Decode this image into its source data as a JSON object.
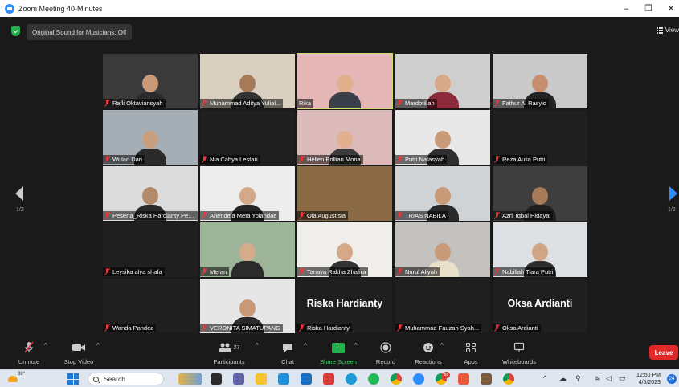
{
  "window": {
    "title": "Zoom Meeting 40-Minutes",
    "minimize": "–",
    "maximize": "❐",
    "close": "✕"
  },
  "topbar": {
    "sound_button": "Original Sound for Musicians: Off",
    "view_label": "View"
  },
  "gallery": {
    "page_left": "1/2",
    "page_right": "1/2",
    "tiles": [
      {
        "name": "Rafli Oktaviansyah",
        "bg": "#3a3a3a",
        "skin": "#c89a78",
        "cloth": "#2b2b2b"
      },
      {
        "name": "Muhammad Aditya Yulial...",
        "bg": "#d8cfc0",
        "skin": "#a87a5a",
        "cloth": "#333"
      },
      {
        "name": "Rika",
        "bg": "#e4b6b6",
        "skin": "#e0b08c",
        "cloth": "#3a3f4a",
        "active": true
      },
      {
        "name": "Mardotillah",
        "bg": "#cfcfcf",
        "skin": "#d8a888",
        "cloth": "#8a2a3a"
      },
      {
        "name": "Fathur Al Rasyid",
        "bg": "#c9c9c9",
        "skin": "#c49070",
        "cloth": "#222"
      },
      {
        "name": "Wulan Dari",
        "bg": "#a6aeb5",
        "skin": "#c8a080",
        "cloth": "#2a2a2a"
      },
      {
        "name": "Nia Cahya Lestari",
        "bg": "#1f1f1f",
        "skin": "#1f1f1f",
        "cloth": "#1f1f1f"
      },
      {
        "name": "Hellen Brillian Mona",
        "bg": "#ddbaba",
        "skin": "#e0b090",
        "cloth": "#3b3b3b"
      },
      {
        "name": "Putri Natasyah",
        "bg": "#e8e8e8",
        "skin": "#c89a78",
        "cloth": "#2f2f2f"
      },
      {
        "name": "Reza Aulia Putri",
        "bg": "#1f1f1f",
        "skin": "#1f1f1f",
        "cloth": "#1f1f1f"
      },
      {
        "name": "Peserta_Riska Hardianty Pen...",
        "bg": "#dcdcdc",
        "skin": "#b08a6a",
        "cloth": "#2b2b2b"
      },
      {
        "name": "Anendela Meta Yolandae",
        "bg": "#ededed",
        "skin": "#d4a888",
        "cloth": "#262626"
      },
      {
        "name": "Ola Augustisia",
        "bg": "#8a6b45",
        "skin": "#8a6b45",
        "cloth": "#5a8a4a"
      },
      {
        "name": "TRIAS NABILA",
        "bg": "#cfd3d6",
        "skin": "#c89a78",
        "cloth": "#2a2a2a"
      },
      {
        "name": "Azril Iqbal Hidayat",
        "bg": "#3e3e3e",
        "skin": "#a87a5a",
        "cloth": "#1f1f1f"
      },
      {
        "name": "Leysika alya shafa",
        "bg": "#1f1f1f",
        "skin": "#1f1f1f",
        "cloth": "#1f1f1f"
      },
      {
        "name": "Meran",
        "bg": "#9fb59a",
        "skin": "#d6ab8c",
        "cloth": "#2b2b2b"
      },
      {
        "name": "Tanaya Rakha Zhafira",
        "bg": "#f0eeea",
        "skin": "#d4a888",
        "cloth": "#333"
      },
      {
        "name": "Nurul Aliyah",
        "bg": "#c4c2be",
        "skin": "#c89a78",
        "cloth": "#e8e0c8"
      },
      {
        "name": "Nabillah Tiara Putri",
        "bg": "#dde0e3",
        "skin": "#d0a484",
        "cloth": "#2e2e2e"
      },
      {
        "name": "Wanda Pandea",
        "bg": "#1f1f1f",
        "skin": "#1f1f1f",
        "cloth": "#1f1f1f"
      },
      {
        "name": "VERONITA SIMATUPANG",
        "bg": "#e6e6e6",
        "skin": "#c89a78",
        "cloth": "#2a2a2a"
      },
      {
        "name": "Riska Hardianty",
        "bg": "#1f1f1f",
        "big": "Riska Hardianty"
      },
      {
        "name": "Muhammad Fauzan Syah...",
        "bg": "#1f1f1f",
        "skin": "#1f1f1f",
        "cloth": "#1f1f1f"
      },
      {
        "name": "Oksa Ardianti",
        "bg": "#1f1f1f",
        "big": "Oksa Ardianti"
      }
    ]
  },
  "toolbar": {
    "unmute": "Unmute",
    "stop_video": "Stop Video",
    "participants": "Participants",
    "participants_count": "27",
    "chat": "Chat",
    "share_screen": "Share Screen",
    "record": "Record",
    "reactions": "Reactions",
    "apps": "Apps",
    "whiteboards": "Whiteboards",
    "leave": "Leave"
  },
  "taskbar": {
    "temperature": "89°",
    "search_placeholder": "Search",
    "chrome_badge": "88",
    "time": "12:50 PM",
    "date": "4/5/2023",
    "notifications": "24"
  }
}
